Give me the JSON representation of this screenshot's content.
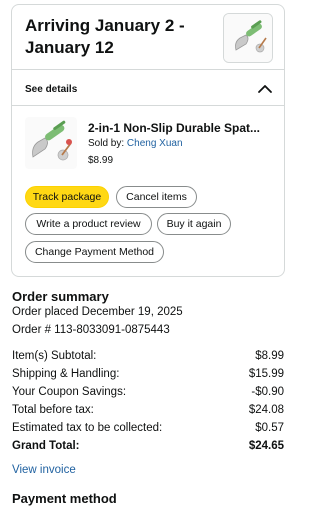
{
  "shipment": {
    "arrival": "Arriving January 2 - January 12",
    "see_details": "See details"
  },
  "item": {
    "title": "2-in-1 Non-Slip Durable Spat...",
    "sold_by_label": "Sold by: ",
    "seller": "Cheng Xuan",
    "price": "$8.99"
  },
  "actions": {
    "track": "Track package",
    "cancel": "Cancel items",
    "review": "Write a product review",
    "buy_again": "Buy it again",
    "change_payment": "Change Payment Method"
  },
  "summary": {
    "title": "Order summary",
    "placed": "Order placed December 19, 2025",
    "order_number": "Order # 113-8033091-0875443",
    "rows": [
      {
        "label": "Item(s) Subtotal:",
        "value": "$8.99"
      },
      {
        "label": "Shipping & Handling:",
        "value": "$15.99"
      },
      {
        "label": "Your Coupon Savings:",
        "value": "-$0.90"
      },
      {
        "label": "Total before tax:",
        "value": "$24.08"
      },
      {
        "label": "Estimated tax to be collected:",
        "value": "$0.57"
      },
      {
        "label": "Grand Total:",
        "value": "$24.65"
      }
    ],
    "view_invoice": "View invoice"
  },
  "footer_cutoff": "Payment method",
  "colors": {
    "link": "#2162a1",
    "primary_button": "#ffd814",
    "border": "#d5d9d9"
  },
  "icons": {
    "chevron": "chevron-up-icon",
    "product": "spatula-product-image"
  }
}
